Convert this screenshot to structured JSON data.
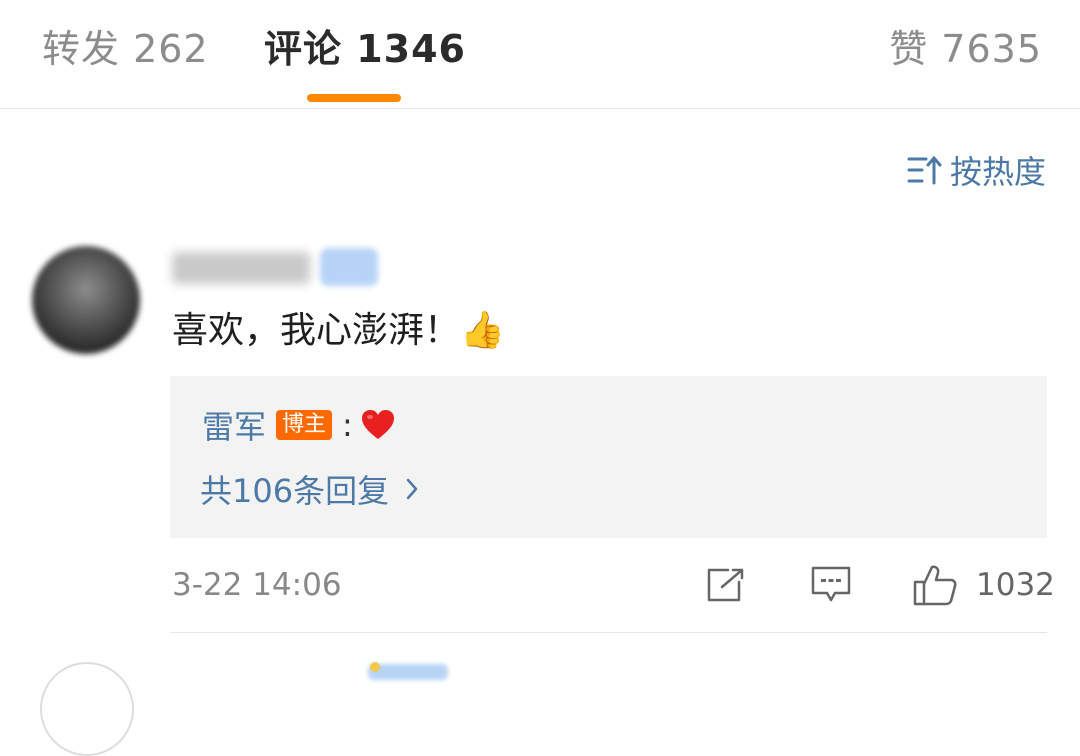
{
  "tabs": {
    "repost": "转发 262",
    "comments": "评论 1346",
    "likes": "赞 7635"
  },
  "sort": {
    "label": "按热度",
    "icon": "sort-icon"
  },
  "comment": {
    "author_name": "••••",
    "text": "喜欢，我心澎湃！👍",
    "reply": {
      "author": "雷军",
      "tag": "博主",
      "colon": ":",
      "emoji_icon": "heart-icon"
    },
    "reply_count": "共106条回复",
    "timestamp": "3-22 14:06",
    "like_count": "1032"
  },
  "colors": {
    "accent": "#ff8a00",
    "link": "#4d79a6",
    "blogger_tag": "#ff6a00"
  }
}
